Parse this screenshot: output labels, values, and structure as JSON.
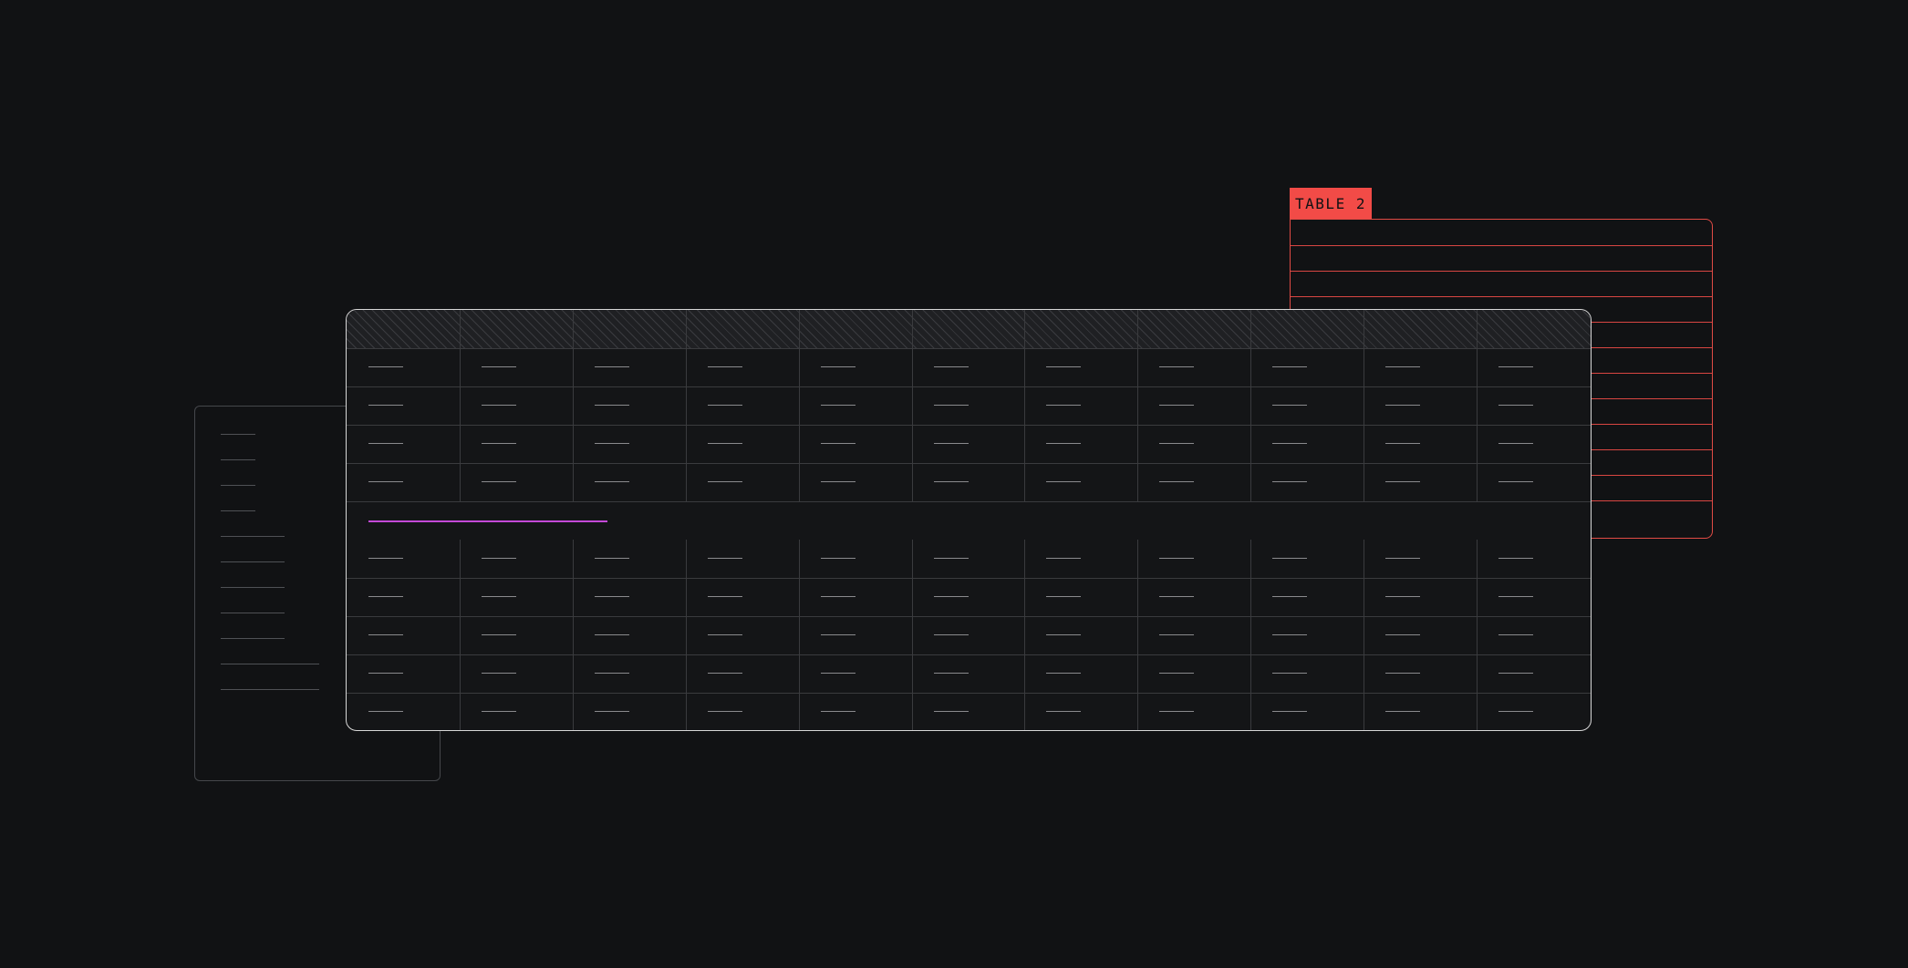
{
  "table2": {
    "label": "TABLE 2",
    "row_count": 12,
    "accent_color": "#f24b47"
  },
  "main_table": {
    "columns": 11,
    "rows_above_highlight": 4,
    "rows_below_highlight": 5,
    "header_style": "hatched",
    "border_color": "#d8d8d8",
    "highlight_color": "#c44ad8"
  },
  "side_panel": {
    "line_count": 11
  },
  "colors": {
    "background": "#111214"
  }
}
